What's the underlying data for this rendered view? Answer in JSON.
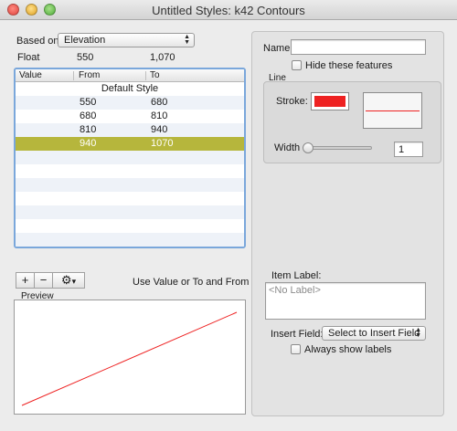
{
  "window": {
    "title": "Untitled Styles: k42 Contours"
  },
  "based_on": {
    "label": "Based on:",
    "value": "Elevation"
  },
  "field_info": {
    "type": "Float",
    "min": "550",
    "max": "1,070"
  },
  "table": {
    "columns": [
      "Value",
      "From",
      "To"
    ],
    "default_row": "Default Style",
    "rows": [
      {
        "from": "550",
        "to": "680"
      },
      {
        "from": "680",
        "to": "810"
      },
      {
        "from": "810",
        "to": "940"
      },
      {
        "from": "940",
        "to": "1070"
      }
    ],
    "selected_row": 3
  },
  "toolbar": {
    "add": "+",
    "remove": "−",
    "gear": "⚙",
    "menu_arrow": "▾"
  },
  "mode_text": "Use Value or To and From",
  "preview": {
    "label": "Preview"
  },
  "name": {
    "label": "Name:",
    "value": ""
  },
  "hide_features": {
    "label": "Hide these features",
    "checked": false
  },
  "line": {
    "group_label": "Line",
    "stroke_label": "Stroke:",
    "stroke_color": "#ee2222",
    "width_label": "Width",
    "width_value": "1"
  },
  "item_label": {
    "label": "Item Label:",
    "placeholder": "<No Label>"
  },
  "insert_field": {
    "label": "Insert Field:",
    "value": "Select to Insert Field"
  },
  "always_show_labels": {
    "label": "Always show labels",
    "checked": false
  },
  "colors": {
    "selection": "#b6b63c",
    "accent_blue": "#7aa7db",
    "line_red": "#ee2222"
  }
}
